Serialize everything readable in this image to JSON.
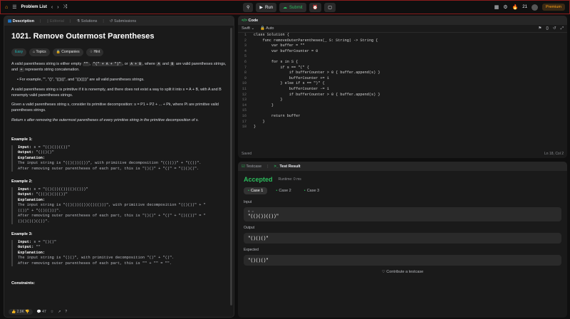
{
  "topbar": {
    "title": "Problem List",
    "run": "Run",
    "submit": "Submit",
    "streak": "21",
    "premium": "Premium"
  },
  "left": {
    "tabs": [
      "Description",
      "Editorial",
      "Solutions",
      "Submissions"
    ],
    "title": "1021. Remove Outermost Parentheses",
    "tags": [
      "Easy",
      "Topics",
      "Companies",
      "Hint"
    ],
    "p1a": "A valid parentheses string is either empty ",
    "p1b": "\"\"",
    ", ": "",
    "p1c": ", ",
    "p1d": "\"(\" + A + \")\"",
    "p1e": ", or ",
    "p1f": "A + B",
    "p1g": ", where ",
    "p1h": "A",
    "p1i": " and ",
    "p1j": "B",
    "p1k": " are valid parentheses strings, and ",
    "p1l": "+",
    "p1m": " represents string concatenation.",
    "bullet": "For example, \"\", \"()\", \"(())()\", and \"(()(()))\" are all valid parentheses strings.",
    "p2": "A valid parentheses string s is primitive if it is nonempty, and there does not exist a way to split it into s = A + B, with A and B nonempty valid parentheses strings.",
    "p3": "Given a valid parentheses string s, consider its primitive decomposition: s = P1 + P2 + ... + Pk, where Pi are primitive valid parentheses strings.",
    "p4": "Return s after removing the outermost parentheses of every primitive string in the primitive decomposition of s.",
    "examples": [
      {
        "h": "Example 1:",
        "input": "s = \"(()())(())\"",
        "output": "\"()()()\"",
        "expl": [
          "The input string is \"(()())(())\", with primitive decomposition \"(()())\" + \"(())\".",
          "After removing outer parentheses of each part, this is \"()()\" + \"()\" = \"()()()\"."
        ]
      },
      {
        "h": "Example 2:",
        "input": "s = \"(()())(())(()(()))\"",
        "output": "\"()()()()(())\"",
        "expl": [
          "The input string is \"(()())(())(()(()))\", with primitive decomposition \"(()())\" + \"",
          "(())\" + \"(()(()))\".",
          "After removing outer parentheses of each part, this is \"()()\" + \"()\" + \"()(())\" = \"",
          "()()()()(())\"."
        ]
      },
      {
        "h": "Example 3:",
        "input": "s = \"()()\"",
        "output": "\"\"",
        "expl": [
          "The input string is \"()()\", with primitive decomposition \"()\" + \"()\".",
          "After removing outer parentheses of each part, this is \"\" + \"\" = \"\"."
        ]
      }
    ],
    "constraints": "Constraints:",
    "footer": {
      "likes": "2.9K",
      "comments": "47"
    }
  },
  "code": {
    "tab": "Code",
    "lang": "Swift",
    "auto": "Auto",
    "saved": "Saved",
    "pos": "Ln 18, Col 2",
    "lines": [
      "class Solution {",
      "    func removeOuterParentheses(_ S: String) -> String {",
      "        var buffer = \"\"",
      "        var bufferCounter = 0",
      "",
      "        for s in S {",
      "            if s == \"(\" {",
      "                if bufferCounter > 0 { buffer.append(s) }",
      "                bufferCounter += 1",
      "            } else if s == \")\" {",
      "                bufferCounter -= 1",
      "                if bufferCounter > 0 { buffer.append(s) }",
      "            }",
      "        }",
      "",
      "        return buffer",
      "    }",
      "}"
    ]
  },
  "result": {
    "tabs": [
      "Testcase",
      "Test Result"
    ],
    "status": "Accepted",
    "runtime": "Runtime: 0 ms",
    "cases": [
      "Case 1",
      "Case 2",
      "Case 3"
    ],
    "input_label": "Input",
    "input_var": "s =",
    "input_val": "\"(()())(())\"",
    "output_label": "Output",
    "output_val": "\"()()()\"",
    "expected_label": "Expected",
    "expected_val": "\"()()()\"",
    "contribute": "Contribute a testcase"
  }
}
